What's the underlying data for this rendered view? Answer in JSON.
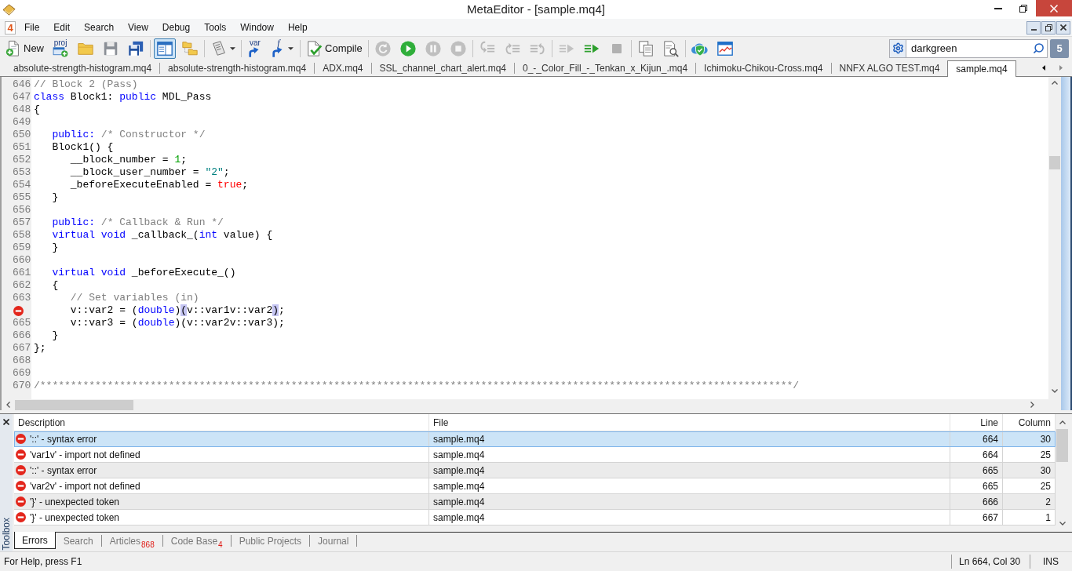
{
  "window": {
    "title": "MetaEditor - [sample.mq4]"
  },
  "menu": {
    "app_badge": "4",
    "items": [
      "File",
      "Edit",
      "Search",
      "View",
      "Debug",
      "Tools",
      "Window",
      "Help"
    ]
  },
  "toolbar": {
    "groups": [
      [
        {
          "kind": "labeled",
          "label": "New",
          "pressed": false,
          "disabled": false,
          "dropdown": false
        },
        {
          "kind": "captioned",
          "label": "proj",
          "pressed": false,
          "disabled": false,
          "dropdown": false
        },
        {
          "kind": "icon",
          "pressed": false,
          "disabled": false,
          "dropdown": false
        },
        {
          "kind": "icon",
          "pressed": false,
          "disabled": false,
          "dropdown": false
        },
        {
          "kind": "icon",
          "pressed": false,
          "disabled": false,
          "dropdown": false
        }
      ],
      [
        {
          "kind": "icon",
          "pressed": true,
          "disabled": false,
          "dropdown": false
        },
        {
          "kind": "icon",
          "pressed": false,
          "disabled": false,
          "dropdown": false
        }
      ],
      [
        {
          "kind": "icon",
          "pressed": false,
          "disabled": false,
          "dropdown": true
        }
      ],
      [
        {
          "kind": "captioned",
          "label": "var",
          "pressed": false,
          "disabled": false,
          "dropdown": false
        },
        {
          "kind": "captioned",
          "label": "f",
          "pressed": false,
          "disabled": false,
          "dropdown": true
        }
      ],
      [
        {
          "kind": "labeled",
          "label": "Compile",
          "pressed": false,
          "disabled": false,
          "dropdown": false
        }
      ],
      [
        {
          "kind": "icon",
          "pressed": false,
          "disabled": true,
          "dropdown": false
        },
        {
          "kind": "icon",
          "pressed": false,
          "disabled": false,
          "dropdown": false
        },
        {
          "kind": "icon",
          "pressed": false,
          "disabled": true,
          "dropdown": false
        },
        {
          "kind": "icon",
          "pressed": false,
          "disabled": true,
          "dropdown": false
        }
      ],
      [
        {
          "kind": "icon",
          "pressed": false,
          "disabled": true,
          "dropdown": false
        },
        {
          "kind": "icon",
          "pressed": false,
          "disabled": true,
          "dropdown": false
        },
        {
          "kind": "icon",
          "pressed": false,
          "disabled": true,
          "dropdown": false
        }
      ],
      [
        {
          "kind": "icon",
          "pressed": false,
          "disabled": true,
          "dropdown": false
        },
        {
          "kind": "icon",
          "pressed": false,
          "disabled": false,
          "dropdown": false
        },
        {
          "kind": "icon",
          "pressed": false,
          "disabled": true,
          "dropdown": false
        }
      ],
      [
        {
          "kind": "icon",
          "pressed": false,
          "disabled": false,
          "dropdown": false
        },
        {
          "kind": "icon",
          "pressed": false,
          "disabled": false,
          "dropdown": false
        }
      ],
      [
        {
          "kind": "icon",
          "pressed": false,
          "disabled": false,
          "dropdown": false
        },
        {
          "kind": "icon",
          "pressed": false,
          "disabled": false,
          "dropdown": false
        }
      ]
    ],
    "search": {
      "value": "darkgreen"
    },
    "notifications": "5"
  },
  "tabs": [
    {
      "label": "absolute-strength-histogram.mq4",
      "selected": false
    },
    {
      "label": "absolute-strength-histogram.mq4",
      "selected": false
    },
    {
      "label": "ADX.mq4",
      "selected": false
    },
    {
      "label": "SSL_channel_chart_alert.mq4",
      "selected": false
    },
    {
      "label": "0_-_Color_Fill_-_Tenkan_x_Kijun_.mq4",
      "selected": false
    },
    {
      "label": "Ichimoku-Chikou-Cross.mq4",
      "selected": false
    },
    {
      "label": "NNFX ALGO TEST.mq4",
      "selected": false
    },
    {
      "label": "sample.mq4",
      "selected": true
    }
  ],
  "editor": {
    "lines": [
      {
        "kind": "numbered",
        "number": "646",
        "tokens": [
          {
            "kind": "comment",
            "text": "// Block 2 (Pass)"
          }
        ]
      },
      {
        "kind": "numbered",
        "number": "647",
        "tokens": [
          {
            "kind": "keyword",
            "text": "class"
          },
          {
            "kind": "plain",
            "text": " Block1: "
          },
          {
            "kind": "keyword",
            "text": "public"
          },
          {
            "kind": "plain",
            "text": " MDL_Pass"
          }
        ]
      },
      {
        "kind": "numbered",
        "number": "648",
        "tokens": [
          {
            "kind": "plain",
            "text": "{"
          }
        ]
      },
      {
        "kind": "numbered",
        "number": "649"
      },
      {
        "kind": "numbered",
        "number": "650",
        "tokens": [
          {
            "kind": "keyword",
            "text": "   public: "
          },
          {
            "kind": "comment",
            "text": "/* Constructor */"
          }
        ]
      },
      {
        "kind": "numbered",
        "number": "651",
        "tokens": [
          {
            "kind": "plain",
            "text": "   Block1() {"
          }
        ]
      },
      {
        "kind": "numbered",
        "number": "652",
        "tokens": [
          {
            "kind": "plain",
            "text": "      __block_number = "
          },
          {
            "kind": "number",
            "text": "1"
          },
          {
            "kind": "plain",
            "text": ";"
          }
        ]
      },
      {
        "kind": "numbered",
        "number": "653",
        "tokens": [
          {
            "kind": "plain",
            "text": "      __block_user_number = "
          },
          {
            "kind": "string",
            "text": "\"2\""
          },
          {
            "kind": "plain",
            "text": ";"
          }
        ]
      },
      {
        "kind": "numbered",
        "number": "654",
        "tokens": [
          {
            "kind": "plain",
            "text": "      _beforeExecuteEnabled = "
          },
          {
            "kind": "literal",
            "text": "true"
          },
          {
            "kind": "plain",
            "text": ";"
          }
        ]
      },
      {
        "kind": "numbered",
        "number": "655",
        "tokens": [
          {
            "kind": "plain",
            "text": "   }"
          }
        ]
      },
      {
        "kind": "numbered",
        "number": "656"
      },
      {
        "kind": "numbered",
        "number": "657",
        "tokens": [
          {
            "kind": "keyword",
            "text": "   public: "
          },
          {
            "kind": "comment",
            "text": "/* Callback & Run */"
          }
        ]
      },
      {
        "kind": "numbered",
        "number": "658",
        "tokens": [
          {
            "kind": "keyword",
            "text": "   virtual void"
          },
          {
            "kind": "plain",
            "text": " _callback_("
          },
          {
            "kind": "keyword",
            "text": "int"
          },
          {
            "kind": "plain",
            "text": " value) {"
          }
        ]
      },
      {
        "kind": "numbered",
        "number": "659",
        "tokens": [
          {
            "kind": "plain",
            "text": "   }"
          }
        ]
      },
      {
        "kind": "numbered",
        "number": "660"
      },
      {
        "kind": "numbered",
        "number": "661",
        "tokens": [
          {
            "kind": "keyword",
            "text": "   virtual void"
          },
          {
            "kind": "plain",
            "text": " _beforeExecute_()"
          }
        ]
      },
      {
        "kind": "numbered",
        "number": "662",
        "tokens": [
          {
            "kind": "plain",
            "text": "   {"
          }
        ]
      },
      {
        "kind": "numbered",
        "number": "663",
        "tokens": [
          {
            "kind": "comment",
            "text": "      // Set variables (in)"
          }
        ]
      },
      {
        "kind": "error",
        "tokens": [
          {
            "kind": "plain",
            "text": "      v::var2 = ("
          },
          {
            "kind": "keyword",
            "text": "double"
          },
          {
            "kind": "plain",
            "text": ")"
          },
          {
            "kind": "match",
            "text": "("
          },
          {
            "kind": "plain",
            "text": "v::var1v::var2"
          },
          {
            "kind": "match",
            "text": ")"
          },
          {
            "kind": "plain",
            "text": ";"
          }
        ]
      },
      {
        "kind": "numbered",
        "number": "665",
        "tokens": [
          {
            "kind": "plain",
            "text": "      v::var3 = ("
          },
          {
            "kind": "keyword",
            "text": "double"
          },
          {
            "kind": "plain",
            "text": ")(v::var2v::var3);"
          }
        ]
      },
      {
        "kind": "numbered",
        "number": "666",
        "tokens": [
          {
            "kind": "plain",
            "text": "   }"
          }
        ]
      },
      {
        "kind": "numbered",
        "number": "667",
        "tokens": [
          {
            "kind": "plain",
            "text": "};"
          }
        ]
      },
      {
        "kind": "numbered",
        "number": "668"
      },
      {
        "kind": "numbered",
        "number": "669"
      },
      {
        "kind": "numbered",
        "number": "670",
        "tokens": [
          {
            "kind": "comment",
            "text": "/***************************************************************************************************************************/"
          }
        ]
      }
    ]
  },
  "toolbox": {
    "title": "Toolbox",
    "columns": [
      "Description",
      "File",
      "Line",
      "Column"
    ],
    "rows": [
      {
        "description": "'::' - syntax error",
        "file": "sample.mq4",
        "line": "664",
        "column": "30",
        "selected": true
      },
      {
        "description": "'var1v' - import not defined",
        "file": "sample.mq4",
        "line": "664",
        "column": "25",
        "selected": false
      },
      {
        "description": "'::' - syntax error",
        "file": "sample.mq4",
        "line": "665",
        "column": "30",
        "selected": false
      },
      {
        "description": "'var2v' - import not defined",
        "file": "sample.mq4",
        "line": "665",
        "column": "25",
        "selected": false
      },
      {
        "description": "'}' - unexpected token",
        "file": "sample.mq4",
        "line": "666",
        "column": "2",
        "selected": false
      },
      {
        "description": "'}' - unexpected token",
        "file": "sample.mq4",
        "line": "667",
        "column": "1",
        "selected": false
      }
    ],
    "tabs": [
      {
        "label": "Errors",
        "selected": true
      },
      {
        "label": "Search",
        "selected": false
      },
      {
        "label": "Articles",
        "count": "868",
        "selected": false
      },
      {
        "label": "Code Base",
        "count": "4",
        "selected": false
      },
      {
        "label": "Public Projects",
        "selected": false
      },
      {
        "label": "Journal",
        "selected": false
      }
    ]
  },
  "status_bar": {
    "help": "For Help, press F1",
    "position": "Ln 664, Col 30",
    "mode": "INS"
  }
}
